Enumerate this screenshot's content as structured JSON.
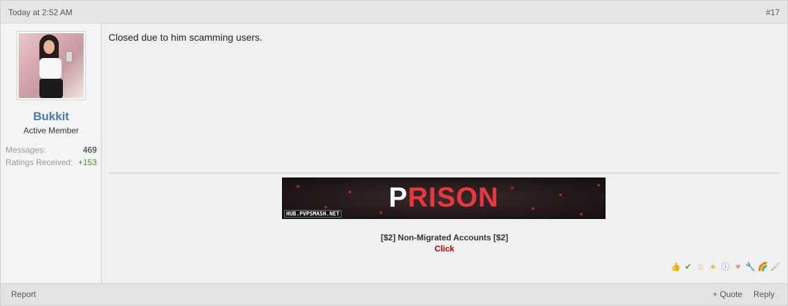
{
  "post": {
    "date": "Today at 2:52 AM",
    "number": "#17",
    "message": "Closed due to him scamming users."
  },
  "author": {
    "username": "Bukkit",
    "title": "Active Member",
    "stats": [
      {
        "label": "Messages:",
        "value": "469"
      },
      {
        "label": "Ratings Received:",
        "value": "+153"
      }
    ]
  },
  "signature": {
    "banner_first_letter": "P",
    "banner_rest": "RISON",
    "banner_domain": "HUB.PVPSMASH.NET",
    "line1": "[$2] Non-Migrated Accounts [$2]",
    "line2": "Click"
  },
  "ratings": {
    "icons": [
      "thumbs-up-icon",
      "check-icon",
      "laugh-icon",
      "star-icon",
      "info-icon",
      "heart-icon",
      "wrench-icon",
      "rainbow-icon",
      "paintbrush-icon"
    ]
  },
  "footer": {
    "report": "Report",
    "quote": "+ Quote",
    "reply": "Reply"
  },
  "colors": {
    "username": "#4a78b5",
    "positive": "#3e9a24",
    "link_red": "#b50000",
    "banner_red": "#e8383d"
  }
}
